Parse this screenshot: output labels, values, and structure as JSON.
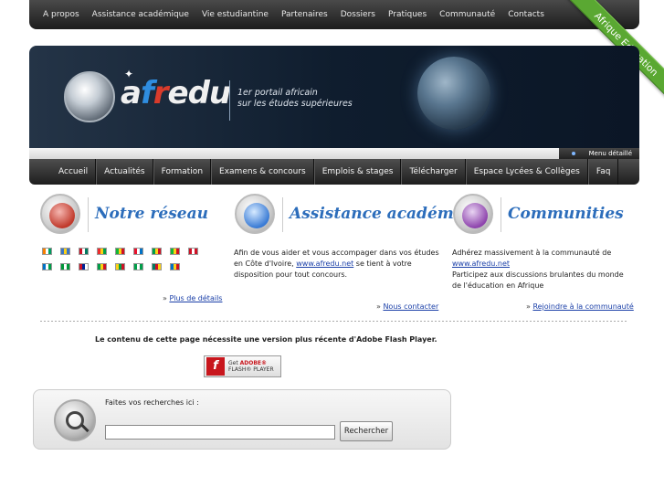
{
  "top_nav": {
    "items": [
      "A propos",
      "Assistance académique",
      "Vie estudiantine",
      "Partenaires",
      "Dossiers",
      "Pratiques",
      "Communauté",
      "Contacts"
    ]
  },
  "ribbon": {
    "label": "Afrique Education",
    "color": "#5aa832"
  },
  "banner": {
    "logo": {
      "a": "a",
      "f": "f",
      "r": "r",
      "e": "e",
      "du": "du"
    },
    "tagline_line1": "1er portail africain",
    "tagline_line2": "sur les études supérieures",
    "menu_detail": "Menu détaillé"
  },
  "main_nav": {
    "items": [
      "Accueil",
      "Actualités",
      "Formation",
      "Examens & concours",
      "Emplois & stages",
      "Télécharger",
      "Espace Lycées & Collèges",
      "Faq"
    ]
  },
  "columns": {
    "reseau": {
      "heading": "Notre réseau",
      "more_prefix": "» ",
      "more_link": "Plus de détails",
      "flags_row1": [
        [
          "#f77f00",
          "#ffffff",
          "#009e60"
        ],
        [
          "#3a75c4",
          "#fcd116",
          "#3a75c4"
        ],
        [
          "#ce1126",
          "#ffffff",
          "#007a5e"
        ],
        [
          "#ef2b2d",
          "#fcd116",
          "#009e49"
        ],
        [
          "#14b53a",
          "#fcd116",
          "#ce1126"
        ],
        [
          "#e8112d",
          "#ffffff",
          "#0072c6"
        ],
        [
          "#009e49",
          "#fcd116",
          "#ce1126"
        ],
        [
          "#14b53a",
          "#fcd116",
          "#ce1126"
        ],
        [
          "#ce1126",
          "#ffffff",
          "#ce1126"
        ]
      ],
      "flags_row2": [
        [
          "#0072c6",
          "#ffffff",
          "#009e49"
        ],
        [
          "#009639",
          "#ffffff",
          "#009639"
        ],
        [
          "#ce1126",
          "#002395",
          "#ffffff"
        ],
        [
          "#009e49",
          "#fcd116",
          "#ce1126"
        ],
        [
          "#fcd116",
          "#009e49",
          "#ce1126"
        ],
        [
          "#009e49",
          "#ffffff",
          "#009e49"
        ],
        [
          "#007a5e",
          "#ce1126",
          "#fcd116"
        ],
        [
          "#0072c6",
          "#fcd116",
          "#ce1126"
        ]
      ],
      "icon_color": "#c0392b"
    },
    "assistance": {
      "heading": "Assistance académique",
      "text_before": "Afin de vous aider et vous accompager dans vos études en Côte d'Ivoire, ",
      "link_text": "www.afredu.net",
      "text_after": " se tient à votre disposition pour tout concours.",
      "more_prefix": "» ",
      "more_link": "Nous contacter",
      "icon_color": "#3a7bd5"
    },
    "communities": {
      "heading": "Communities",
      "text_before": "Adhérez massivement à la communauté de ",
      "link_text": "www.afredu.net",
      "text_after": "Participez aux discussions brulantes du monde de l'éducation en Afrique",
      "more_prefix": "» ",
      "more_link": "Rejoindre à la communauté",
      "icon_color": "#8e44ad"
    }
  },
  "flash": {
    "message": "Le contenu de cette page nécessite une version plus récente d'Adobe Flash Player.",
    "btn_line1": "Get ",
    "btn_adobe": "ADOBE®",
    "btn_line2": "FLASH® PLAYER"
  },
  "search": {
    "label": "Faites vos recherches ici :",
    "value": "",
    "button": "Rechercher"
  }
}
